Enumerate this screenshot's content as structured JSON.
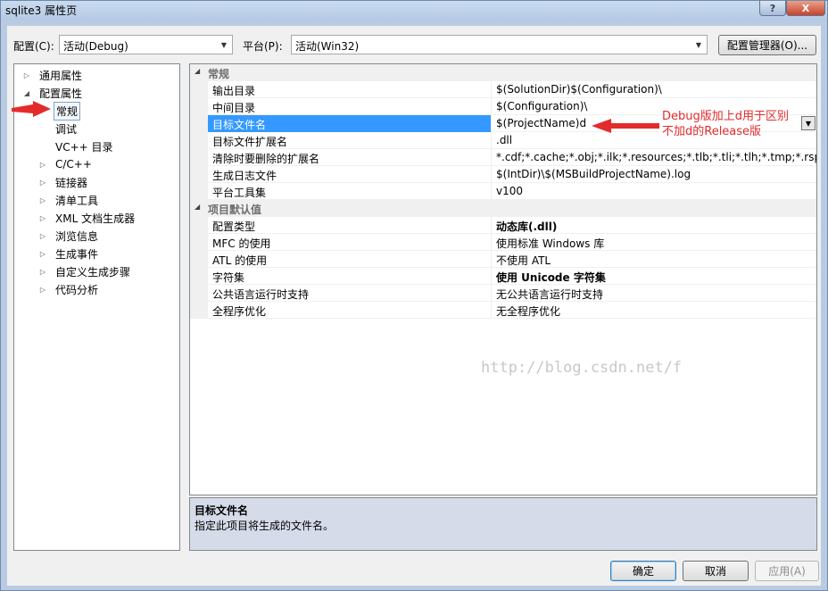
{
  "window": {
    "title": "sqlite3 属性页"
  },
  "titlebar_buttons": {
    "help": "?",
    "close": "X"
  },
  "config": {
    "label": "配置(C):",
    "value": "活动(Debug)"
  },
  "platform": {
    "label": "平台(P):",
    "value": "活动(Win32)"
  },
  "config_manager_label": "配置管理器(O)...",
  "tree": [
    {
      "label": "通用属性",
      "expander": "▷"
    },
    {
      "label": "配置属性",
      "expander": "◢"
    },
    {
      "label": "常规",
      "expander": ""
    },
    {
      "label": "调试",
      "expander": ""
    },
    {
      "label": "VC++ 目录",
      "expander": ""
    },
    {
      "label": "C/C++",
      "expander": "▷"
    },
    {
      "label": "链接器",
      "expander": "▷"
    },
    {
      "label": "清单工具",
      "expander": "▷"
    },
    {
      "label": "XML 文档生成器",
      "expander": "▷"
    },
    {
      "label": "浏览信息",
      "expander": "▷"
    },
    {
      "label": "生成事件",
      "expander": "▷"
    },
    {
      "label": "自定义生成步骤",
      "expander": "▷"
    },
    {
      "label": "代码分析",
      "expander": "▷"
    }
  ],
  "grid": {
    "sections": [
      {
        "title": "常规",
        "expander": "◢",
        "rows": [
          {
            "name": "输出目录",
            "value": "$(SolutionDir)$(Configuration)\\"
          },
          {
            "name": "中间目录",
            "value": "$(Configuration)\\"
          },
          {
            "name": "目标文件名",
            "value": "$(ProjectName)d"
          },
          {
            "name": "目标文件扩展名",
            "value": ".dll"
          },
          {
            "name": "清除时要删除的扩展名",
            "value": "*.cdf;*.cache;*.obj;*.ilk;*.resources;*.tlb;*.tli;*.tlh;*.tmp;*.rsp;*.pgc"
          },
          {
            "name": "生成日志文件",
            "value": "$(IntDir)\\$(MSBuildProjectName).log"
          },
          {
            "name": "平台工具集",
            "value": "v100"
          }
        ]
      },
      {
        "title": "项目默认值",
        "expander": "◢",
        "rows": [
          {
            "name": "配置类型",
            "value": "动态库(.dll)"
          },
          {
            "name": "MFC 的使用",
            "value": "使用标准 Windows 库"
          },
          {
            "name": "ATL 的使用",
            "value": "不使用 ATL"
          },
          {
            "name": "字符集",
            "value": "使用 Unicode 字符集"
          },
          {
            "name": "公共语言运行时支持",
            "value": "无公共语言运行时支持"
          },
          {
            "name": "全程序优化",
            "value": "无全程序优化"
          }
        ]
      }
    ],
    "dropdown_glyph": "▼"
  },
  "watermark": "http://blog.csdn.net/f",
  "description": {
    "title": "目标文件名",
    "text": "指定此项目将生成的文件名。"
  },
  "buttons": {
    "ok": "确定",
    "cancel": "取消",
    "apply": "应用(A)"
  },
  "annotation": {
    "line1": "Debug版加上d用于区别",
    "line2": "不加d的Release版"
  },
  "colors": {
    "selection": "#3399ff",
    "annotation": "#e32b2b",
    "arrow": "#e32b2b"
  }
}
